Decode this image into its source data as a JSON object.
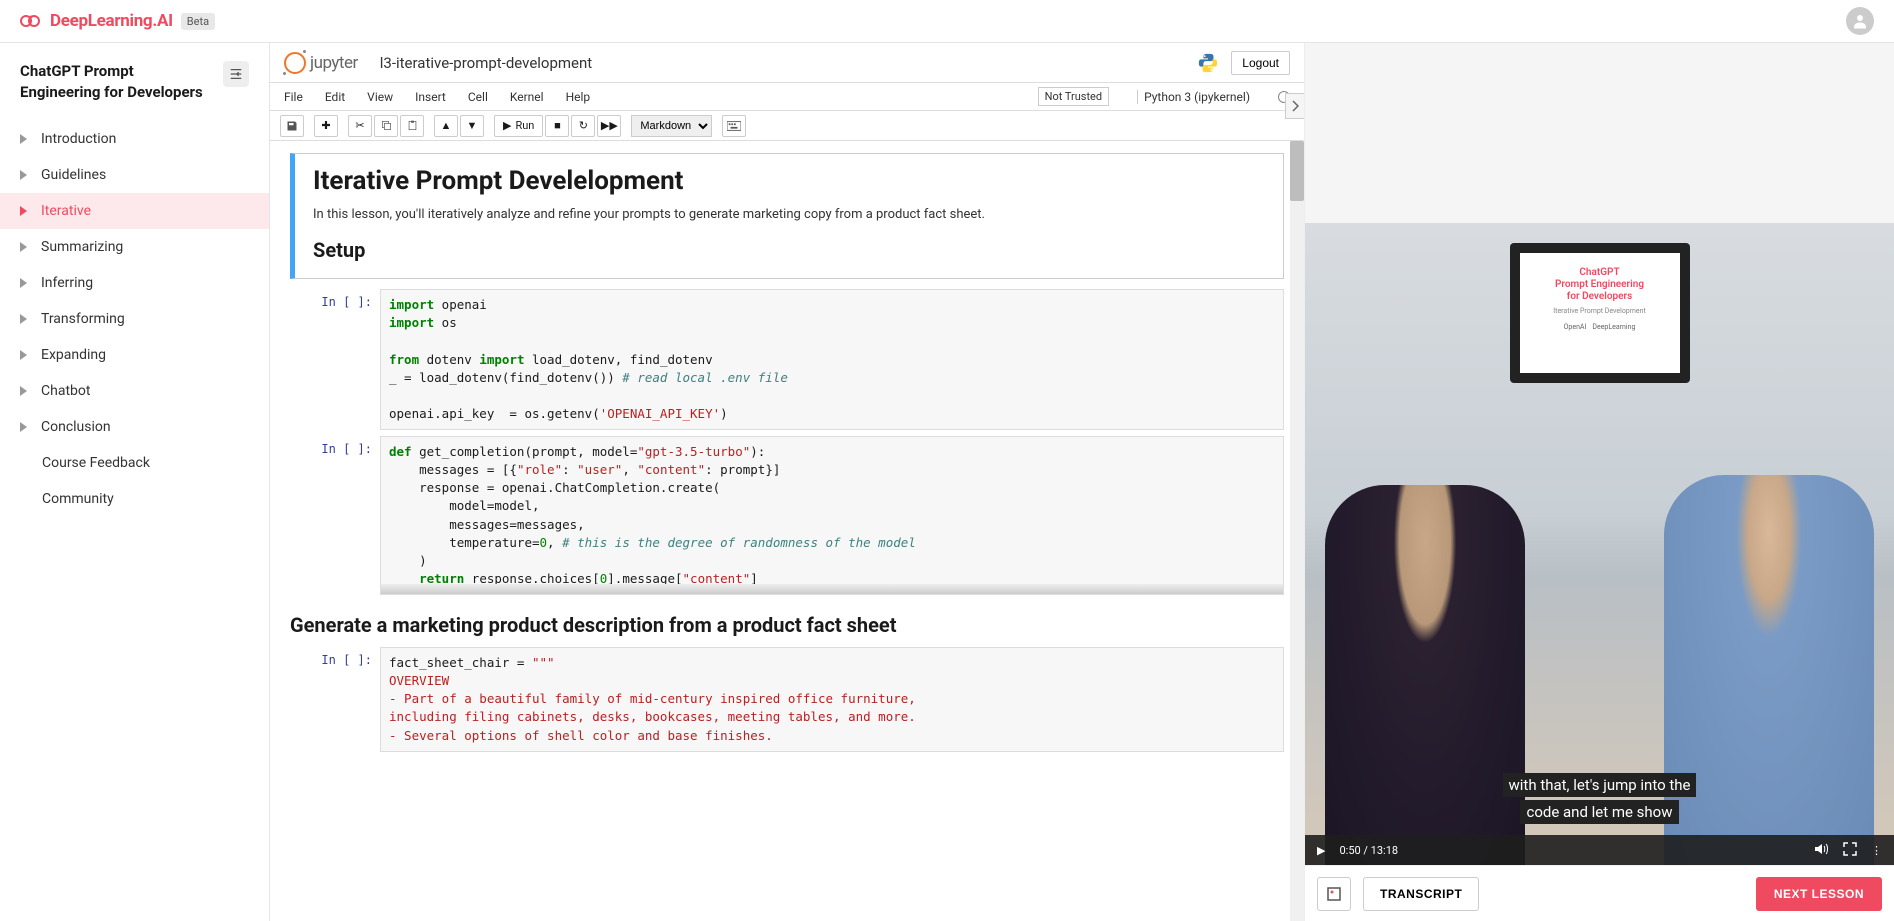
{
  "header": {
    "brand": "DeepLearning.AI",
    "beta": "Beta"
  },
  "sidebar": {
    "course_title": "ChatGPT Prompt Engineering for Developers",
    "items": [
      {
        "label": "Introduction",
        "icon": true,
        "active": false
      },
      {
        "label": "Guidelines",
        "icon": true,
        "active": false
      },
      {
        "label": "Iterative",
        "icon": true,
        "active": true
      },
      {
        "label": "Summarizing",
        "icon": true,
        "active": false
      },
      {
        "label": "Inferring",
        "icon": true,
        "active": false
      },
      {
        "label": "Transforming",
        "icon": true,
        "active": false
      },
      {
        "label": "Expanding",
        "icon": true,
        "active": false
      },
      {
        "label": "Chatbot",
        "icon": true,
        "active": false
      },
      {
        "label": "Conclusion",
        "icon": true,
        "active": false
      },
      {
        "label": "Course Feedback",
        "icon": false,
        "active": false
      },
      {
        "label": "Community",
        "icon": false,
        "active": false
      }
    ]
  },
  "jupyter": {
    "logo_text": "jupyter",
    "notebook_name": "l3-iterative-prompt-development",
    "logout": "Logout",
    "menus": [
      "File",
      "Edit",
      "View",
      "Insert",
      "Cell",
      "Kernel",
      "Help"
    ],
    "not_trusted": "Not Trusted",
    "kernel": "Python 3 (ipykernel)",
    "run_label": "Run",
    "cell_type": "Markdown",
    "md1_title": "Iterative Prompt Develelopment",
    "md1_desc": "In this lesson, you'll iteratively analyze and refine your prompts to generate marketing copy from a product fact sheet.",
    "md1_h2": "Setup",
    "section2": "Generate a marketing product description from a product fact sheet",
    "prompts": {
      "in_empty": "In [ ]:"
    },
    "code1": {
      "l1a": "import",
      "l1b": " openai",
      "l2a": "import",
      "l2b": " os",
      "l3a": "from",
      "l3b": " dotenv ",
      "l3c": "import",
      "l3d": " load_dotenv, find_dotenv",
      "l4a": "_ = load_dotenv(find_dotenv()) ",
      "l4b": "# read local .env file",
      "l5a": "openai.api_key  = os.getenv(",
      "l5b": "'OPENAI_API_KEY'",
      "l5c": ")"
    },
    "code2": {
      "l1a": "def",
      "l1b": " get_completion(prompt, model=",
      "l1c": "\"gpt-3.5-turbo\"",
      "l1d": "):",
      "l2a": "    messages = [{",
      "l2b": "\"role\"",
      "l2c": ": ",
      "l2d": "\"user\"",
      "l2e": ", ",
      "l2f": "\"content\"",
      "l2g": ": prompt}]",
      "l3": "    response = openai.ChatCompletion.create(",
      "l4": "        model=model,",
      "l5": "        messages=messages,",
      "l6a": "        temperature=",
      "l6b": "0",
      "l6c": ", ",
      "l6d": "# this is the degree of randomness of the model",
      "l7": "    )",
      "l8a": "    ",
      "l8b": "return",
      "l8c": " response.choices[",
      "l8d": "0",
      "l8e": "].message[",
      "l8f": "\"content\"",
      "l8g": "]"
    },
    "code3": {
      "l1a": "fact_sheet_chair = ",
      "l1b": "\"\"\"",
      "l2": "OVERVIEW",
      "l3": "- Part of a beautiful family of mid-century inspired office furniture,",
      "l4": "including filing cabinets, desks, bookcases, meeting tables, and more.",
      "l5": "- Several options of shell color and base finishes."
    }
  },
  "video": {
    "monitor_title": "ChatGPT\nPrompt Engineering\nfor Developers",
    "monitor_sub": "Iterative Prompt Development",
    "monitor_logo1": "OpenAI",
    "monitor_logo2": "DeepLearning",
    "caption1": "with that, let's jump into the",
    "caption2": "code and let me show",
    "time": "0:50 / 13:18"
  },
  "bottom": {
    "transcript": "TRANSCRIPT",
    "next": "NEXT LESSON"
  }
}
